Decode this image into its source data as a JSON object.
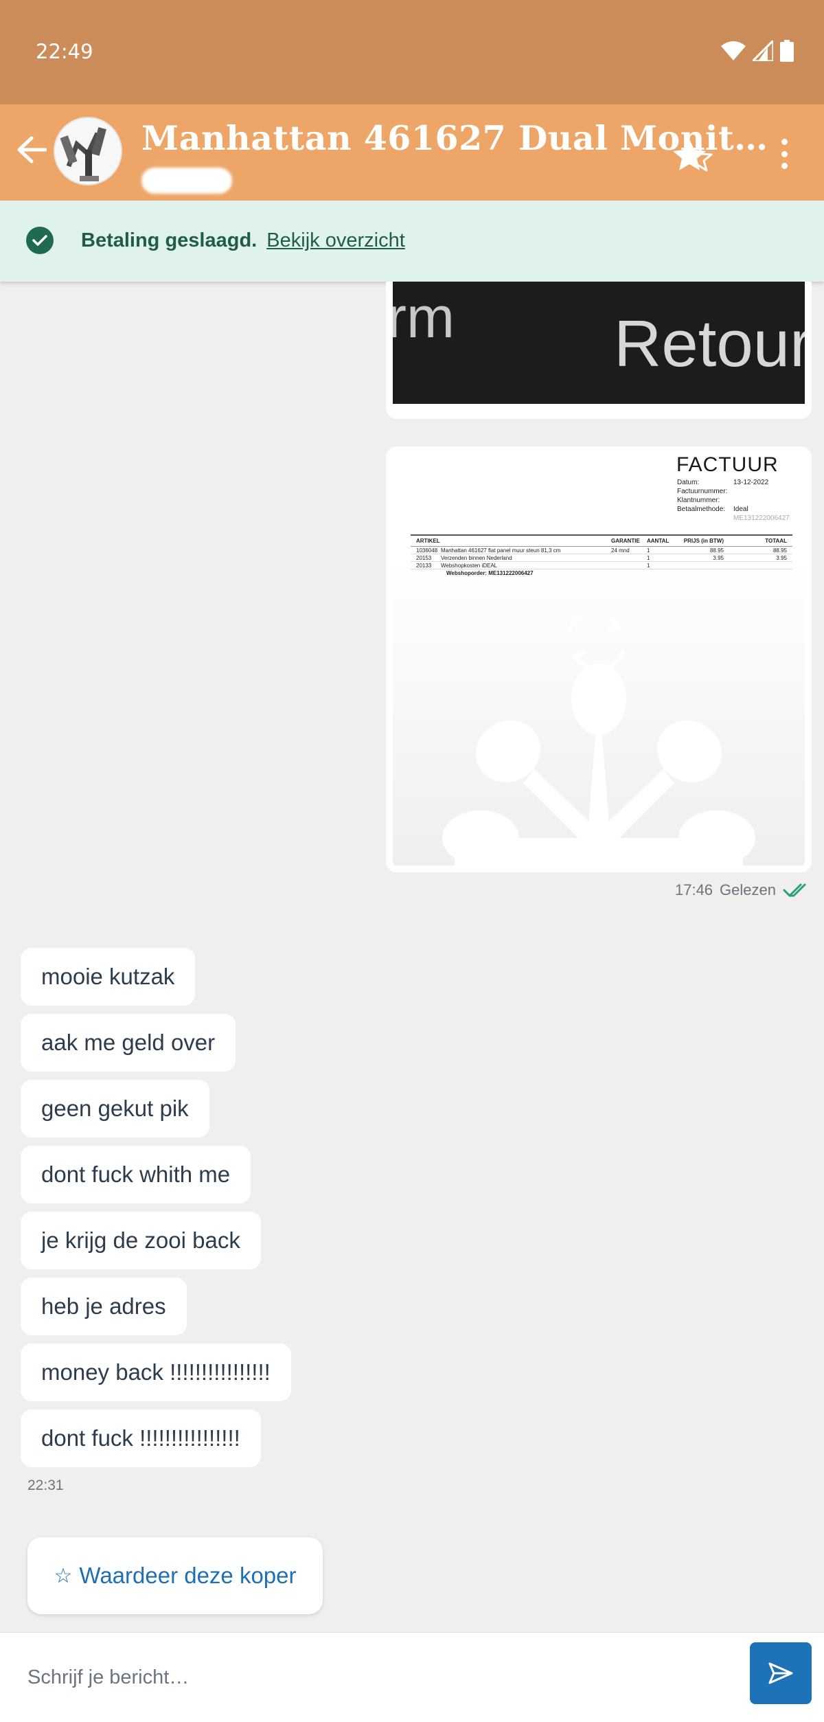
{
  "status_bar": {
    "time": "22:49",
    "icons": [
      "wifi-icon",
      "signal-icon",
      "battery-icon"
    ]
  },
  "app_bar": {
    "title": "Manhattan 461627 Dual Monit…",
    "icons": [
      "back-arrow-icon",
      "star-rate-icon",
      "more-vert-icon"
    ]
  },
  "banner": {
    "text": "Betaling geslaagd.",
    "link": "Bekijk overzicht",
    "icon": "check-circle-icon"
  },
  "conversation": {
    "image_top": {
      "text_arm": "rm",
      "text_retour": "Retour"
    },
    "invoice": {
      "title": "FACTUUR",
      "meta": [
        {
          "label": "Datum:",
          "value": "13-12-2022"
        },
        {
          "label": "Factuurnummer:",
          "value": ""
        },
        {
          "label": "Klantnummer:",
          "value": ""
        },
        {
          "label": "Betaalmethode:",
          "value": "Ideal"
        }
      ],
      "reference": "ME131222006427",
      "headers": [
        "ARTIKEL",
        "",
        "GARANTIE",
        "AANTAL",
        "PRIJS (in BTW)",
        "TOTAAL"
      ],
      "rows": [
        [
          "1036048",
          "Manhattan 461627 flat panel muur steun 81,3 cm",
          "24 mnd",
          "1",
          "88.95",
          "88.95"
        ],
        [
          "20153",
          "Verzenden binnen Nederland",
          "",
          "1",
          "3.95",
          "3.95"
        ],
        [
          "20133",
          "Webshopkosten iDEAL",
          "",
          "1",
          "",
          ""
        ]
      ],
      "order": "Webshoporder: ME131222006427"
    },
    "sent_time": "17:46",
    "read_status": "Gelezen",
    "incoming": [
      "mooie kutzak",
      "aak me geld over",
      "geen gekut pik",
      "dont fuck whith me",
      "je krijg de zooi back",
      "heb je adres",
      "money back !!!!!!!!!!!!!!!!",
      "dont fuck !!!!!!!!!!!!!!!!"
    ],
    "incoming_time": "22:31"
  },
  "rate_button": {
    "label": "Waardeer deze koper",
    "icon": "star-outline-icon"
  },
  "composer": {
    "placeholder": "Schrijf je bericht…",
    "icon": "send-icon"
  },
  "colors": {
    "status_bar": "#cc8c5a",
    "app_bar": "#eea668",
    "banner_bg": "#e0f2ee",
    "banner_text": "#1f5e45",
    "accent_blue": "#1d72b8",
    "chat_bg": "#f0efed"
  }
}
